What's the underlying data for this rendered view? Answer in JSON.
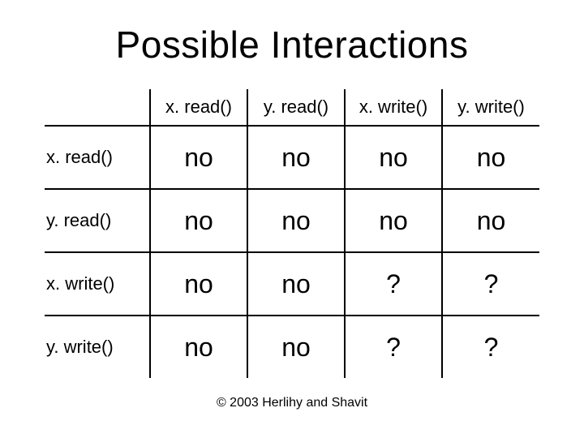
{
  "title": "Possible Interactions",
  "columns": [
    "x. read()",
    "y. read()",
    "x. write()",
    "y. write()"
  ],
  "rows": [
    {
      "label": "x. read()",
      "cells": [
        "no",
        "no",
        "no",
        "no"
      ]
    },
    {
      "label": "y. read()",
      "cells": [
        "no",
        "no",
        "no",
        "no"
      ]
    },
    {
      "label": "x. write()",
      "cells": [
        "no",
        "no",
        "?",
        "?"
      ]
    },
    {
      "label": "y. write()",
      "cells": [
        "no",
        "no",
        "?",
        "?"
      ]
    }
  ],
  "footer": "© 2003 Herlihy and Shavit"
}
